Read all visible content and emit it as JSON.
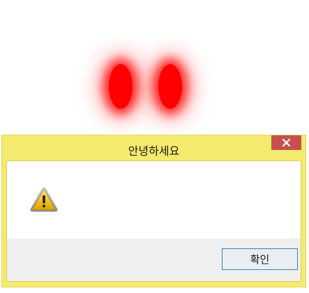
{
  "dialog": {
    "title": "안녕하세요",
    "icon": "warning-icon",
    "ok_label": "확인",
    "close_icon": "close-icon"
  },
  "decoration": {
    "eye_color": "#ff0000"
  },
  "colors": {
    "dialog_frame": "#f4ea6d",
    "close_button": "#c7504f",
    "footer": "#efefef",
    "button_border": "#3c7fb1"
  }
}
